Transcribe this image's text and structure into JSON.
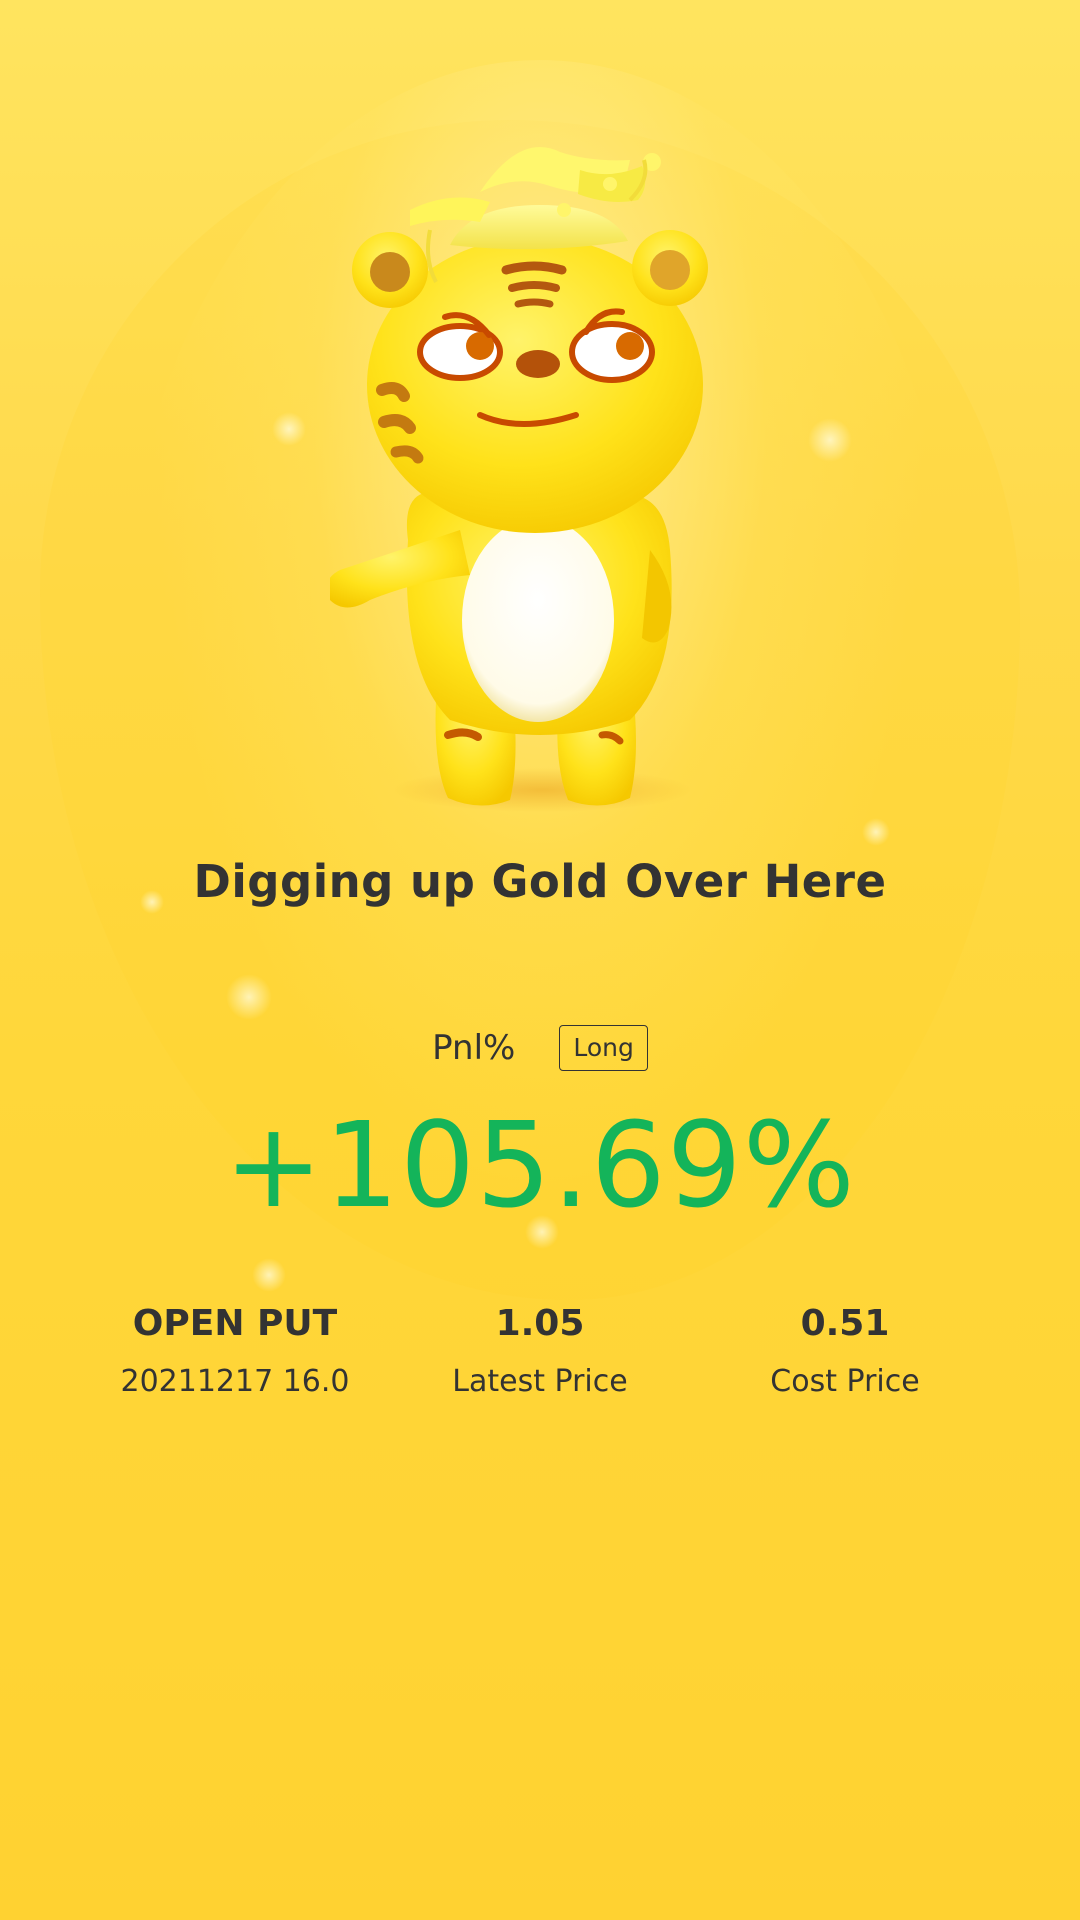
{
  "headline": "Digging up Gold Over Here",
  "pnl": {
    "label": "Pnl%",
    "side": "Long",
    "value": "+105.69%",
    "value_color": "#14b45a"
  },
  "stats": [
    {
      "main": "OPEN PUT",
      "sub": "20211217 16.0"
    },
    {
      "main": "1.05",
      "sub": "Latest Price"
    },
    {
      "main": "0.51",
      "sub": "Cost Price"
    }
  ],
  "theme": {
    "background": "#ffd94a",
    "text": "#333333"
  },
  "mascot": {
    "icon": "tiger-mascot-with-gold-ingot-hat"
  }
}
